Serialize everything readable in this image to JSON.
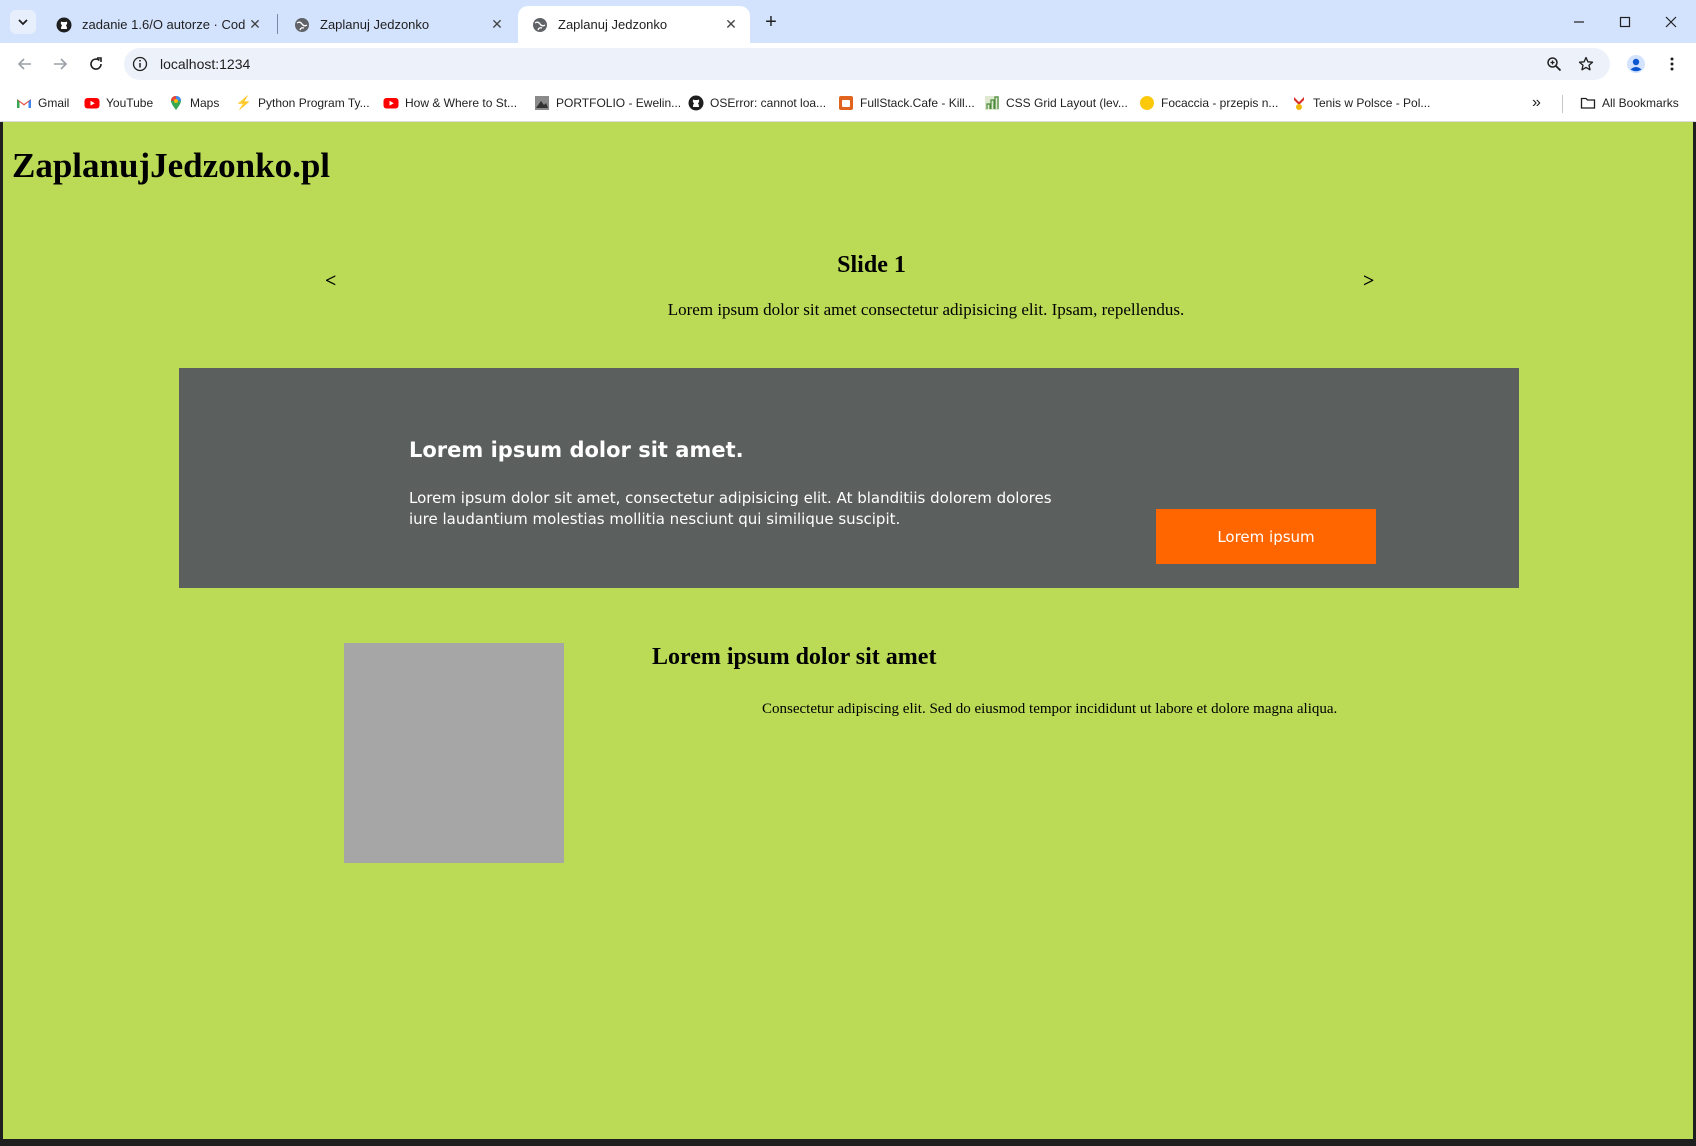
{
  "browser": {
    "tabs": [
      {
        "title": "zadanie 1.6/O autorze · Coders",
        "icon": "github-icon",
        "active": false
      },
      {
        "title": "Zaplanuj Jedzonko",
        "icon": "globe-icon",
        "active": false
      },
      {
        "title": "Zaplanuj Jedzonko",
        "icon": "globe-icon",
        "active": true
      }
    ],
    "new_tab": "+",
    "url": "localhost:1234",
    "bookmarks": [
      {
        "label": "Gmail",
        "icon": "gmail-icon"
      },
      {
        "label": "YouTube",
        "icon": "youtube-icon"
      },
      {
        "label": "Maps",
        "icon": "maps-icon"
      },
      {
        "label": "Python Program Ty...",
        "icon": "bolt-icon"
      },
      {
        "label": "How & Where to St...",
        "icon": "youtube-icon"
      },
      {
        "label": "PORTFOLIO - Ewelin...",
        "icon": "portfolio-icon"
      },
      {
        "label": "OSError: cannot loa...",
        "icon": "github-icon"
      },
      {
        "label": "FullStack.Cafe - Kill...",
        "icon": "fullstack-icon"
      },
      {
        "label": "CSS Grid Layout (lev...",
        "icon": "grid-icon"
      },
      {
        "label": "Focaccia - przepis n...",
        "icon": "yellow-dot-icon"
      },
      {
        "label": "Tenis w Polsce - Pol...",
        "icon": "tennis-icon"
      }
    ],
    "more_bookmarks": "»",
    "all_bookmarks": "All Bookmarks"
  },
  "page": {
    "logo": "ZaplanujJedzonko.pl",
    "slider": {
      "prev": "<",
      "next": ">",
      "title": "Slide 1",
      "text": "Lorem ipsum dolor sit amet consectetur adipisicing elit. Ipsam, repellendus."
    },
    "banner": {
      "title": "Lorem ipsum dolor sit amet.",
      "text": "Lorem ipsum dolor sit amet, consectetur adipisicing elit. At blanditiis dolorem dolores iure laudantium molestias mollitia nesciunt qui similique suscipit.",
      "button": "Lorem ipsum"
    },
    "feature": {
      "title": "Lorem ipsum dolor sit amet",
      "text": "Consectetur adipiscing elit. Sed do eiusmod tempor incididunt ut labore et dolore magna aliqua."
    }
  },
  "colors": {
    "page_bg": "#bbdb57",
    "banner_bg": "#5b5f5e",
    "button_bg": "#ff6600",
    "image_placeholder": "#a6a6a6",
    "tabstrip_bg": "#d3e3fd"
  }
}
